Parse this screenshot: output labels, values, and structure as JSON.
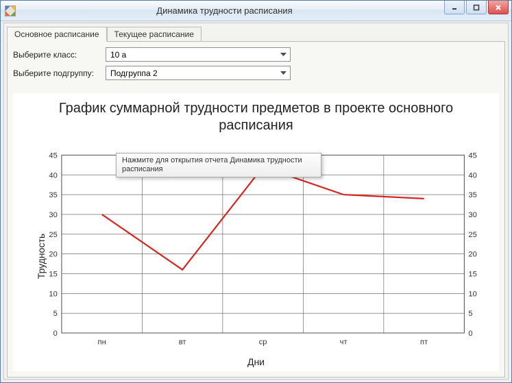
{
  "window": {
    "title": "Динамика трудности расписания"
  },
  "tabs": {
    "active": "Основное расписание",
    "other": "Текущее расписание"
  },
  "form": {
    "class_label": "Выберите класс:",
    "class_value": "10 а",
    "subgroup_label": "Выберите подгруппу:",
    "subgroup_value": "Подгруппа 2"
  },
  "chart_title": "График суммарной трудности предметов в проекте основного расписания",
  "tooltip_text": "Нажмите для открытия отчета Динамика трудности расписания",
  "y_label": "Трудность",
  "x_label": "Дни",
  "chart_data": {
    "type": "line",
    "categories": [
      "пн",
      "вт",
      "ср",
      "чт",
      "пт"
    ],
    "values": [
      30,
      16,
      42,
      35,
      34
    ],
    "ylabel": "Трудность",
    "xlabel": "Дни",
    "ylim": [
      0,
      45
    ],
    "yticks": [
      0,
      5,
      10,
      15,
      20,
      25,
      30,
      35,
      40,
      45
    ],
    "title": "График суммарной трудности предметов в проекте основного расписания",
    "color": "#d42824"
  }
}
